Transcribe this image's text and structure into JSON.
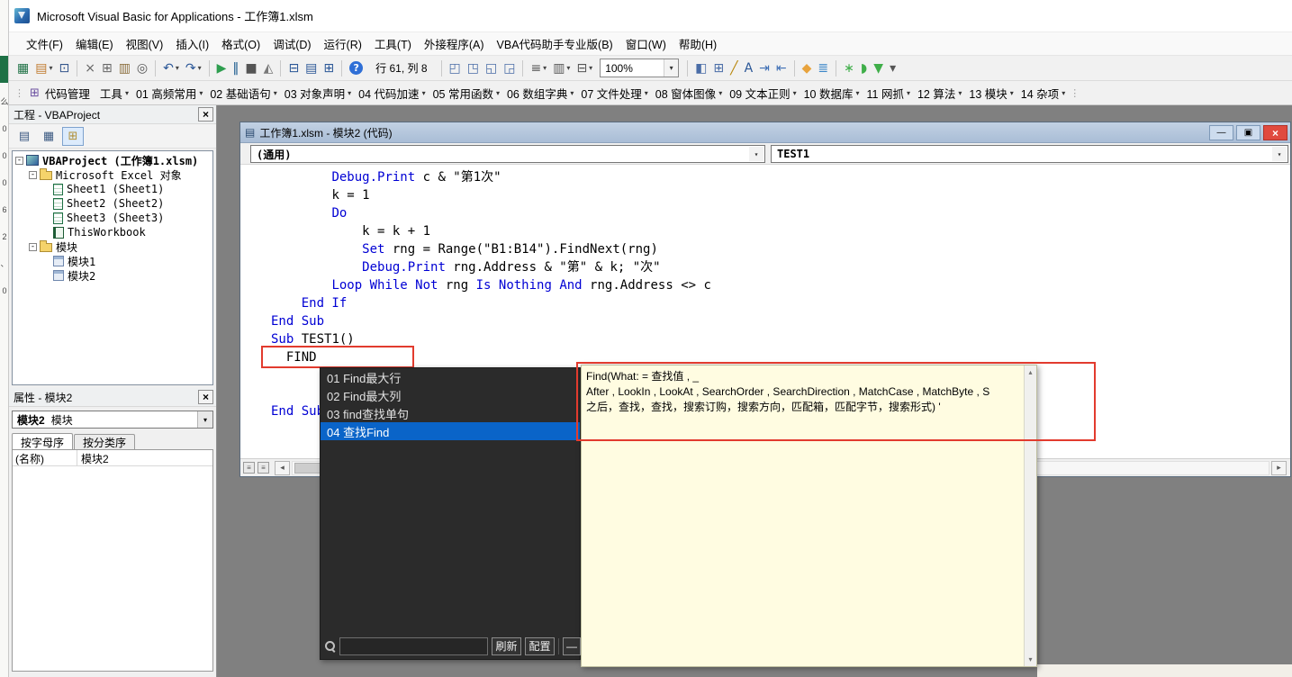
{
  "window": {
    "title": "Microsoft Visual Basic for Applications - 工作簿1.xlsm"
  },
  "menu_bar": {
    "items": [
      "文件(F)",
      "编辑(E)",
      "视图(V)",
      "插入(I)",
      "格式(O)",
      "调试(D)",
      "运行(R)",
      "工具(T)",
      "外接程序(A)",
      "VBA代码助手专业版(B)",
      "窗口(W)",
      "帮助(H)"
    ]
  },
  "status": {
    "cursor_position": "行 61, 列 8",
    "zoom": "100%"
  },
  "toolbar_standard": {
    "items": [
      {
        "type": "icon",
        "name": "view-excel-icon",
        "glyph": "▦",
        "color": "#1e7145"
      },
      {
        "type": "icon",
        "name": "insert-userform-icon",
        "glyph": "▤",
        "color": "#c07b2f",
        "caret": true
      },
      {
        "type": "icon",
        "name": "save-icon",
        "glyph": "⊡",
        "color": "#33568c"
      },
      {
        "type": "sep"
      },
      {
        "type": "icon",
        "name": "cut-icon",
        "glyph": "×",
        "color": "#666666"
      },
      {
        "type": "icon",
        "name": "copy-icon",
        "glyph": "⊞",
        "color": "#666666"
      },
      {
        "type": "icon",
        "name": "paste-icon",
        "glyph": "▥",
        "color": "#8a6d3b"
      },
      {
        "type": "icon",
        "name": "find-icon",
        "glyph": "◎",
        "color": "#555555"
      },
      {
        "type": "sep"
      },
      {
        "type": "icon",
        "name": "undo-icon",
        "glyph": "↶",
        "color": "#2b5797",
        "caret": true
      },
      {
        "type": "icon",
        "name": "redo-icon",
        "glyph": "↷",
        "color": "#2b5797",
        "caret": true
      },
      {
        "type": "sep"
      },
      {
        "type": "icon",
        "name": "run-icon",
        "glyph": "▶",
        "color": "#2e9e4f"
      },
      {
        "type": "icon",
        "name": "break-icon",
        "glyph": "‖",
        "color": "#1d5c8f"
      },
      {
        "type": "icon",
        "name": "reset-icon",
        "glyph": "■",
        "color": "#555555"
      },
      {
        "type": "icon",
        "name": "design-mode-icon",
        "glyph": "◭",
        "color": "#7a7a7a"
      },
      {
        "type": "sep"
      },
      {
        "type": "icon",
        "name": "project-explorer-icon",
        "glyph": "⊟",
        "color": "#2b5797"
      },
      {
        "type": "icon",
        "name": "properties-window-icon",
        "glyph": "▤",
        "color": "#2b5797"
      },
      {
        "type": "icon",
        "name": "object-browser-icon",
        "glyph": "⊞",
        "color": "#2b5797"
      },
      {
        "type": "sep"
      },
      {
        "type": "icon",
        "name": "help-icon",
        "glyph": "?",
        "color": "#ffffff",
        "badge": "#2f6fd6"
      },
      {
        "type": "status"
      },
      {
        "type": "sep"
      },
      {
        "type": "icon",
        "name": "window-tile-icon",
        "glyph": "◰",
        "color": "#4a6da7"
      },
      {
        "type": "icon",
        "name": "window-cascade-icon",
        "glyph": "◳",
        "color": "#4a6da7"
      },
      {
        "type": "icon",
        "name": "window-split-icon",
        "glyph": "◱",
        "color": "#4a6da7"
      },
      {
        "type": "icon",
        "name": "window-arrange-icon",
        "glyph": "◲",
        "color": "#4a6da7"
      },
      {
        "type": "sep"
      },
      {
        "type": "icon",
        "name": "list-format-icon",
        "glyph": "≡",
        "color": "#555555",
        "caret": true
      },
      {
        "type": "icon",
        "name": "image-list-icon",
        "glyph": "▥",
        "color": "#555555",
        "caret": true
      },
      {
        "type": "icon",
        "name": "border-list-icon",
        "glyph": "⊟",
        "color": "#555555",
        "caret": true
      },
      {
        "type": "zoom"
      },
      {
        "type": "sep"
      },
      {
        "type": "icon",
        "name": "screen-split-icon",
        "glyph": "◧",
        "color": "#4a6da7"
      },
      {
        "type": "icon",
        "name": "new-window-icon",
        "glyph": "⊞",
        "color": "#4a6da7"
      },
      {
        "type": "icon",
        "name": "draw-line-icon",
        "glyph": "╱",
        "color": "#b8860b"
      },
      {
        "type": "icon",
        "name": "sort-text-icon",
        "glyph": "A",
        "color": "#2b5797"
      },
      {
        "type": "icon",
        "name": "indent-icon",
        "glyph": "⇥",
        "color": "#3f6fb5"
      },
      {
        "type": "icon",
        "name": "outdent-icon",
        "glyph": "⇤",
        "color": "#3f6fb5"
      },
      {
        "type": "sep"
      },
      {
        "type": "icon",
        "name": "hand-icon",
        "glyph": "◆",
        "color": "#e8a33d"
      },
      {
        "type": "icon",
        "name": "layers-icon",
        "glyph": "≣",
        "color": "#3a86c8"
      },
      {
        "type": "sep"
      },
      {
        "type": "icon",
        "name": "magic-icon",
        "glyph": "∗",
        "color": "#3fae49"
      },
      {
        "type": "icon",
        "name": "brush-icon",
        "glyph": "◗",
        "color": "#3fae49"
      },
      {
        "type": "icon",
        "name": "filter-icon",
        "glyph": "▼",
        "color": "#3fae49"
      },
      {
        "type": "icon",
        "name": "overflow-icon",
        "glyph": "▾",
        "color": "#555555"
      }
    ]
  },
  "toolbar_assistant": {
    "manage_label": "代码管理",
    "items": [
      "工具",
      "01 高频常用",
      "02 基础语句",
      "03 对象声明",
      "04 代码加速",
      "05 常用函数",
      "06 数组字典",
      "07 文件处理",
      "08 窗体图像",
      "09 文本正则",
      "10 数据库",
      "11 网抓",
      "12 算法",
      "13 模块",
      "14 杂项"
    ]
  },
  "project_panel": {
    "title": "工程 - VBAProject",
    "toolbar": [
      {
        "name": "view-code-icon",
        "glyph": "▤"
      },
      {
        "name": "view-object-icon",
        "glyph": "▦"
      },
      {
        "name": "toggle-folders-icon",
        "glyph": "⊞",
        "pressed": true
      }
    ],
    "tree": [
      {
        "label": "VBAProject (工作簿1.xlsm)",
        "level": 0,
        "icon": "project",
        "expanded": true,
        "bold": true
      },
      {
        "label": "Microsoft Excel 对象",
        "level": 1,
        "icon": "folder",
        "expanded": true
      },
      {
        "label": "Sheet1 (Sheet1)",
        "level": 2,
        "icon": "sheet"
      },
      {
        "label": "Sheet2 (Sheet2)",
        "level": 2,
        "icon": "sheet"
      },
      {
        "label": "Sheet3 (Sheet3)",
        "level": 2,
        "icon": "sheet"
      },
      {
        "label": "ThisWorkbook",
        "level": 2,
        "icon": "book"
      },
      {
        "label": "模块",
        "level": 1,
        "icon": "folder",
        "expanded": true
      },
      {
        "label": "模块1",
        "level": 2,
        "icon": "module"
      },
      {
        "label": "模块2",
        "level": 2,
        "icon": "module"
      }
    ]
  },
  "properties_panel": {
    "title": "属性 - 模块2",
    "object_name": "模块2",
    "object_type": "模块",
    "tabs": [
      "按字母序",
      "按分类序"
    ],
    "active_tab": 0,
    "rows": [
      {
        "name": "(名称)",
        "value": "模块2"
      }
    ]
  },
  "code_window": {
    "title": "工作簿1.xlsm - 模块2 (代码)",
    "object_combo": "(通用)",
    "procedure_combo": "TEST1",
    "code_lines": [
      {
        "indent": 8,
        "segments": [
          [
            "Debug.Print",
            "kw"
          ],
          [
            " c & \"第1次\"",
            "id"
          ]
        ]
      },
      {
        "indent": 8,
        "segments": [
          [
            "k = 1",
            "id"
          ]
        ]
      },
      {
        "indent": 8,
        "segments": [
          [
            "Do",
            "kw"
          ]
        ]
      },
      {
        "indent": 12,
        "segments": [
          [
            "k = k + 1",
            "id"
          ]
        ]
      },
      {
        "indent": 12,
        "segments": [
          [
            "Set",
            "kw"
          ],
          [
            " rng = Range(\"B1:B14\").FindNext(rng)",
            "id"
          ]
        ]
      },
      {
        "indent": 12,
        "segments": [
          [
            "Debug.Print",
            "kw"
          ],
          [
            " rng.Address & \"第\" & k; \"次\"",
            "id"
          ]
        ]
      },
      {
        "indent": 8,
        "segments": [
          [
            "Loop While Not",
            "kw"
          ],
          [
            " rng ",
            "id"
          ],
          [
            "Is Nothing And",
            "kw"
          ],
          [
            " rng.Address <> c",
            "id"
          ]
        ]
      },
      {
        "indent": 4,
        "segments": [
          [
            "End If",
            "kw"
          ]
        ]
      },
      {
        "indent": 0,
        "segments": [
          [
            "End Sub",
            "kw"
          ]
        ]
      },
      {
        "indent": 0,
        "segments": [
          [
            "Sub",
            "kw"
          ],
          [
            " TEST1()",
            "id"
          ]
        ]
      },
      {
        "indent": 2,
        "segments": [
          [
            "FIND",
            "id"
          ]
        ]
      },
      {
        "indent": 0,
        "segments": []
      },
      {
        "indent": 0,
        "segments": []
      },
      {
        "indent": 0,
        "segments": [
          [
            "End Sub",
            "kw"
          ]
        ]
      }
    ]
  },
  "autocomplete": {
    "items": [
      {
        "label": "01 Find最大行"
      },
      {
        "label": "02 Find最大列"
      },
      {
        "label": "03 find查找单句"
      },
      {
        "label": "04 查找Find",
        "selected": true
      }
    ],
    "search_value": "",
    "refresh_label": "刷新",
    "config_label": "配置",
    "collapse_label": "—"
  },
  "tooltip_panel": {
    "lines": [
      "Find(What:  = 查找值 , _",
      "After , LookIn , LookAt , SearchOrder , SearchDirection , MatchCase , MatchByte , S",
      "之后，查找，查找，搜索订购，搜索方向，匹配箱，匹配字节，搜索形式) '"
    ]
  },
  "edge_strip": {
    "chars": [
      "么",
      "0",
      "0",
      "0",
      "6",
      "2",
      "、",
      "0"
    ]
  },
  "colors": {
    "keyword": "#0000d4",
    "highlight_box": "#e23b2e",
    "selection": "#0a64c8",
    "popup_bg": "#2b2b2b",
    "tooltip_bg": "#fffce1",
    "mdi_bg": "#808080",
    "code_title_bg": "#b3c6dc"
  }
}
